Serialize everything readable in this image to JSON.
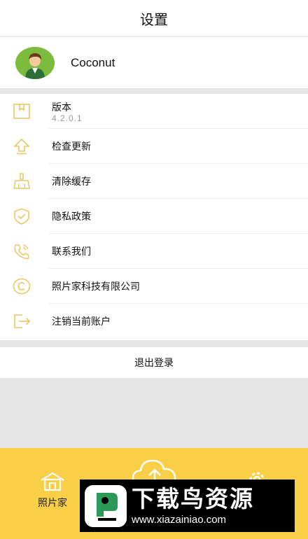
{
  "header": {
    "title": "设置"
  },
  "profile": {
    "name": "Coconut"
  },
  "menu": {
    "version": {
      "label": "版本",
      "value": "4.2.0.1"
    },
    "items": [
      {
        "label": "检查更新",
        "icon": "update-arrow-icon"
      },
      {
        "label": "清除缓存",
        "icon": "broom-icon"
      },
      {
        "label": "隐私政策",
        "icon": "shield-icon"
      },
      {
        "label": "联系我们",
        "icon": "phone-icon"
      },
      {
        "label": "照片家科技有限公司",
        "icon": "copyright-icon"
      },
      {
        "label": "注销当前账户",
        "icon": "exit-icon"
      }
    ]
  },
  "logout": {
    "label": "退出登录"
  },
  "bottom_nav": {
    "home_label": "照片家",
    "accent_color": "#f9cf47"
  },
  "watermark": {
    "title": "下载鸟资源",
    "url": "www.xiazainiao.com"
  },
  "colors": {
    "icon": "#e7c766",
    "background": "#e6e6e6"
  }
}
